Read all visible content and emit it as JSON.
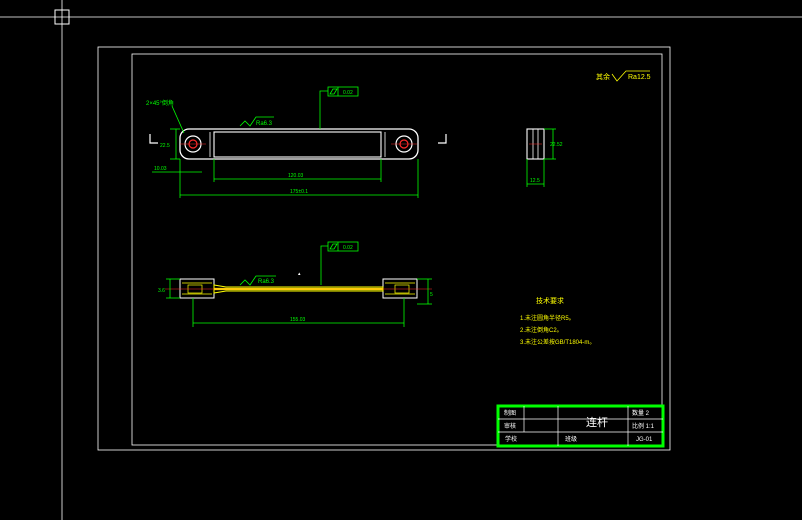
{
  "drawing": {
    "general_roughness": {
      "prefix": "其余",
      "value": "Ra12.5"
    },
    "top_view": {
      "chamfer_label": "2×45°倒角",
      "flatness_tol": "0.02",
      "roughness": "Ra6.3",
      "dim_height": "22.5",
      "dim_left": "10.03",
      "dim_inner": "120.03",
      "dim_total": "175±0.1"
    },
    "side_view": {
      "dim_height": "22.52",
      "dim_width": "12.5"
    },
    "front_view": {
      "flatness_tol": "0.02",
      "roughness": "Ra6.3",
      "dim_left": "3.6",
      "dim_right": "5",
      "dim_center": "155.03"
    },
    "notes": {
      "title": "技术要求",
      "items": [
        "1.未注圆角半径R5。",
        "2.未注倒角C2。",
        "3.未注公差按GB/T1804-m。"
      ]
    },
    "title_block": {
      "drawn_label": "制图",
      "checked_label": "审核",
      "school_label": "学校",
      "class_label": "班级",
      "part_name": "连杆",
      "quantity": "数量 2",
      "scale": "比例 1:1",
      "drawing_no": "JG-01"
    }
  }
}
